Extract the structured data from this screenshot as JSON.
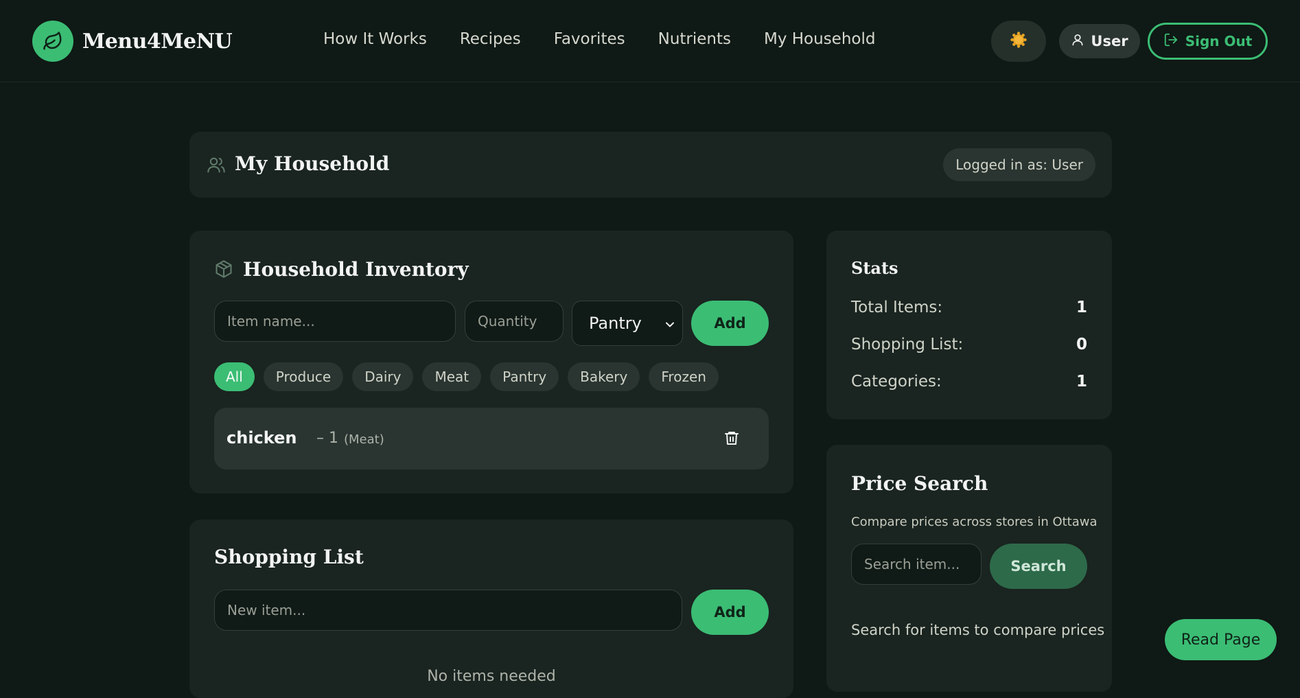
{
  "brand": {
    "name": "Menu4MeNU",
    "logo_icon": "leaf-icon"
  },
  "nav": {
    "links": [
      "How It Works",
      "Recipes",
      "Favorites",
      "Nutrients",
      "My Household"
    ],
    "theme_icon": "sun-icon",
    "user_label": "User",
    "signout_label": "Sign Out"
  },
  "household": {
    "title": "My Household",
    "logged_in": "Logged in as: User"
  },
  "inventory": {
    "title": "Household Inventory",
    "item_placeholder": "Item name...",
    "quantity_placeholder": "Quantity",
    "category_selected": "Pantry",
    "add_label": "Add",
    "filters": [
      "All",
      "Produce",
      "Dairy",
      "Meat",
      "Pantry",
      "Bakery",
      "Frozen"
    ],
    "active_filter": "All",
    "items": [
      {
        "name": "chicken",
        "quantity": "– 1",
        "category": "(Meat)"
      }
    ]
  },
  "shopping": {
    "title": "Shopping List",
    "placeholder": "New item...",
    "add_label": "Add",
    "empty": "No items needed"
  },
  "stats": {
    "title": "Stats",
    "rows": [
      {
        "label": "Total Items:",
        "value": "1"
      },
      {
        "label": "Shopping List:",
        "value": "0"
      },
      {
        "label": "Categories:",
        "value": "1"
      }
    ]
  },
  "price": {
    "title": "Price Search",
    "subtitle": "Compare prices across stores in Ottawa",
    "placeholder": "Search item...",
    "search_label": "Search",
    "hint": "Search for items to compare prices"
  },
  "read_page_label": "Read Page",
  "colors": {
    "accent": "#3bbd74",
    "background": "#0f1915",
    "card": "#1a2420"
  }
}
